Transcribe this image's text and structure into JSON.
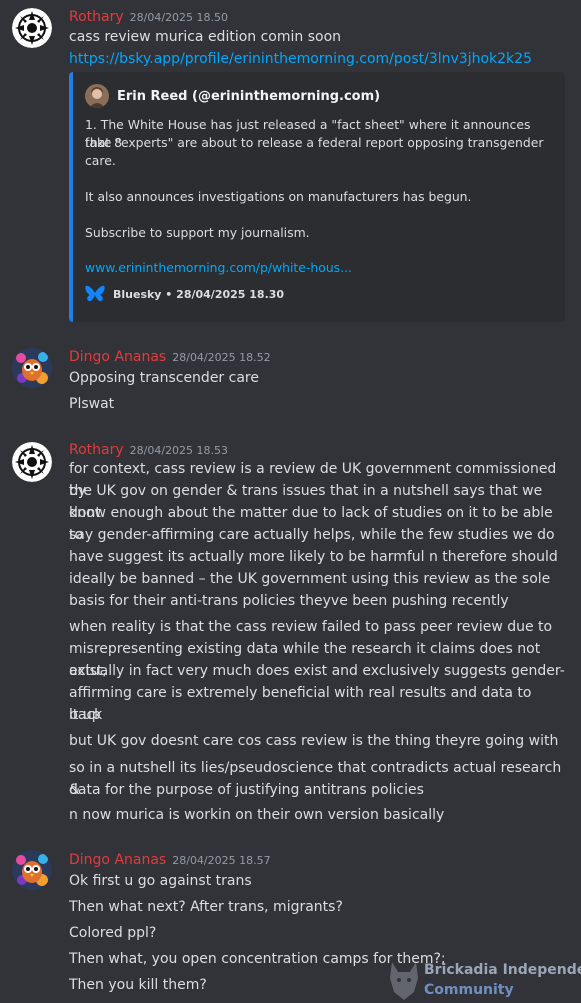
{
  "messages": [
    {
      "author": "Rothary",
      "timestamp": "28/04/2025 18.50",
      "lines": [
        "cass review murica edition comin soon"
      ],
      "link": "https://bsky.app/profile/erininthemorning.com/post/3lnv3jhok2k25",
      "embed": {
        "author": "Erin Reed (@erininthemorning.com)",
        "paragraphs": [
          "1. The White House has just released a \"fact sheet\" where it announces that 8",
          "fake \"experts\" are about to release a federal report opposing transgender",
          "care.",
          "It also announces investigations on manufacturers has begun.",
          "Subscribe to support my journalism."
        ],
        "link": "www.erininthemorning.com/p/white-hous...",
        "footer": "Bluesky • 28/04/2025 18.30"
      }
    },
    {
      "author": "Dingo Ananas",
      "timestamp": "28/04/2025 18.52",
      "lines": [
        "Opposing transcender care",
        "Plswat"
      ]
    },
    {
      "author": "Rothary",
      "timestamp": "28/04/2025 18.53",
      "lines": [
        "for context, cass review is a review de UK government commissioned by",
        "the UK gov on gender & trans issues that in a nutshell says that we dont",
        "know enough about the matter due to lack of studies on it to be able to",
        "say gender-affirming care actually helps, while the few studies we do",
        "have suggest its actually more likely to be harmful n therefore should",
        "ideally be banned – the UK government using this review as the sole",
        "basis for their anti-trans policies theyve been pushing recently",
        "when reality is that the cass review failed to pass peer review due to",
        "misrepresenting existing data while the research it claims does not exist,",
        "actually in fact very much does exist and exclusively suggests gender-",
        "affirming care is extremely beneficial with real results and data to back",
        "it up",
        "but UK gov doesnt care cos cass review is the thing theyre going with",
        "so in a nutshell its lies/pseudoscience that contradicts actual research &",
        "data for the purpose of justifying antitrans policies",
        "n now murica is workin on their own version basically"
      ]
    },
    {
      "author": "Dingo Ananas",
      "timestamp": "28/04/2025 18.57",
      "lines": [
        "Ok first u go against trans",
        "Then what next? After trans, migrants?",
        "Colored ppl?",
        "Then what, you open concentration camps for them?;",
        "Then you kill them?"
      ]
    }
  ],
  "watermark": {
    "line1": "Brickadia Independent",
    "line2": "Community"
  },
  "colors": {
    "background": "#323339",
    "username": "#e23b3b",
    "link": "#00a8fc",
    "embed_bar": "#1f7fe5",
    "embed_bg": "#2b2d31"
  }
}
